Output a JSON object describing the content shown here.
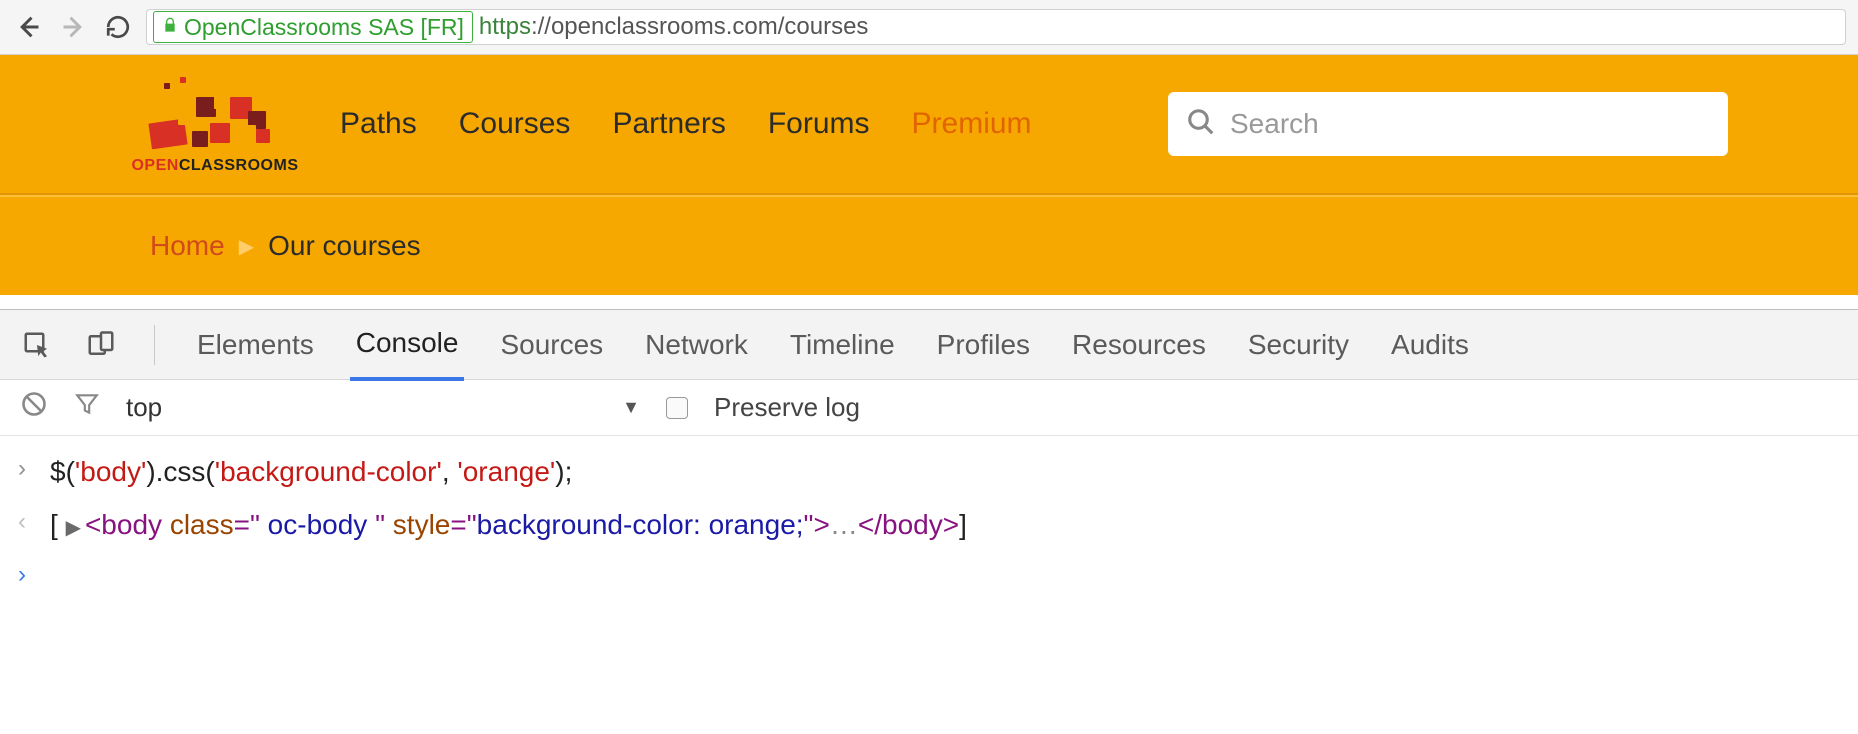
{
  "browser": {
    "cert_label": "OpenClassrooms SAS [FR]",
    "url_protocol": "https",
    "url_rest": "://openclassrooms.com/courses"
  },
  "logo": {
    "word1": "OPEN",
    "word2": "CLASSROOMS"
  },
  "nav": {
    "paths": "Paths",
    "courses": "Courses",
    "partners": "Partners",
    "forums": "Forums",
    "premium": "Premium"
  },
  "search": {
    "placeholder": "Search"
  },
  "breadcrumb": {
    "home": "Home",
    "current": "Our courses"
  },
  "devtools": {
    "tabs": {
      "elements": "Elements",
      "console": "Console",
      "sources": "Sources",
      "network": "Network",
      "timeline": "Timeline",
      "profiles": "Profiles",
      "resources": "Resources",
      "security": "Security",
      "audits": "Audits"
    },
    "context": "top",
    "preserve_log": "Preserve log"
  },
  "console": {
    "input_prefix": "$(",
    "input_sel": "'body'",
    "input_mid1": ").css(",
    "input_arg1": "'background-color'",
    "input_comma": ", ",
    "input_arg2": "'orange'",
    "input_end": ");",
    "out_open": "[ ",
    "out_tag_open": "<body ",
    "out_attr_class": "class",
    "out_eq": "=\"",
    "out_class_val": " oc-body ",
    "out_q": "\" ",
    "out_attr_style": "style",
    "out_style_val": "background-color: orange;",
    "out_tag_mid": ">",
    "out_ellipsis": "…",
    "out_tag_close": "</body>",
    "out_close": "]"
  }
}
